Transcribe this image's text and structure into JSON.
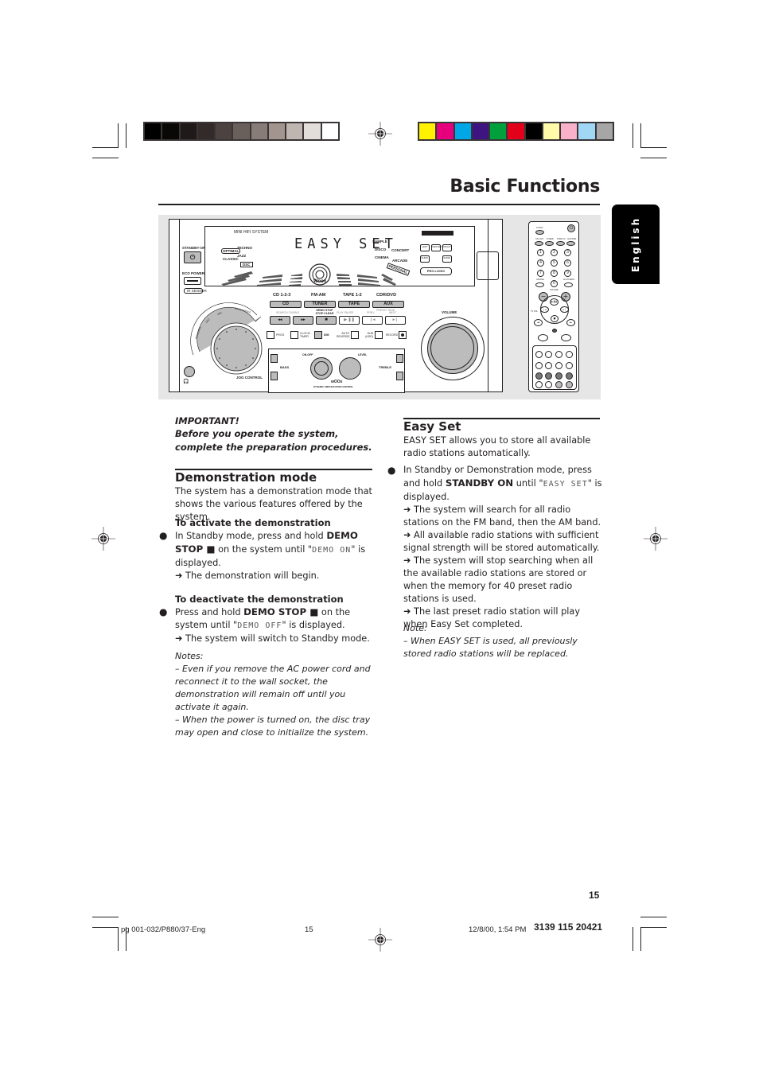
{
  "page": {
    "title": "Basic Functions",
    "language_tab": "English",
    "page_number": "15"
  },
  "color_bars": {
    "grayscale": [
      "#000000",
      "#0a0707",
      "#1f1a19",
      "#332b2a",
      "#4c4340",
      "#6a605b",
      "#877c77",
      "#a2958f",
      "#c0b6b1",
      "#e2ddda",
      "#ffffff"
    ],
    "process": [
      "#fff200",
      "#e6007e",
      "#00a7e7",
      "#3d1480",
      "#00a13d",
      "#e2001a",
      "#000000",
      "#fffaa8",
      "#f8b1c8",
      "#9fd7f4",
      "#a6a6a6"
    ]
  },
  "illustration": {
    "unit": {
      "brand_label": "MINI HIFI SYSTEM",
      "display_text": "EASY SET",
      "standby_label": "STANDBY-ON",
      "eco_power_label": "ECO POWER",
      "ir_sensor_label": "IR SENSOR",
      "source_labels": [
        "CD 1-2-3",
        "FM-AM",
        "TAPE 1-2",
        "CDR/DVD"
      ],
      "source_buttons": [
        "CD",
        "TUNER",
        "TAPE",
        "AUX"
      ],
      "transport_labels": [
        "SEARCH·TUNING",
        "DEMO STOP STOP·CLEAR",
        "PLAY PAUSE",
        "PREV",
        "PRESET SIDE",
        "NEXT"
      ],
      "transport_buttons": [
        "◂◂",
        "▸▸",
        "■",
        "▶ ❚❚",
        "❘◂",
        "▸❘"
      ],
      "function_buttons": [
        "PROG",
        "CLOCK/ TIMER",
        "DIM",
        "AUTO REVERSE",
        "DUB (HSD)",
        "RECORD"
      ],
      "jog_segments": [
        "PERSONAL",
        "DSC",
        "VEC",
        "BASS/TREBLE"
      ],
      "jog_label": "JOG CONTROL",
      "volume_label": "VOLUME",
      "tone": {
        "on_off": "ON-OFF",
        "level": "LEVEL",
        "bass": "BASS",
        "treble": "TREBLE",
        "wooox": "wOOx",
        "subtitle": "DYNAMIC AMPLIFICATION CONTROL"
      },
      "pro_logic_label": "PRO LOGIC",
      "surround_buttons": [
        "LEFT",
        "CENTER",
        "RIGHT",
        "SURR.",
        "SURR."
      ],
      "display_modes_left": [
        "OPTIMAL",
        "TECHNO",
        "CLASSIC",
        "JAZZ",
        "DSC"
      ],
      "display_modes_right": [
        "SAMPLE",
        "DISCO",
        "CONCERT",
        "CINEMA",
        "ARCADE",
        "PERSONAL"
      ],
      "woox_lcd": "Woox"
    },
    "remote": {
      "top_buttons": [
        "TV/AV",
        "CD 1/2/3",
        "TUNER",
        "TAPE 1/2",
        "AUX/CDR"
      ],
      "number_keys": [
        "1",
        "2",
        "3",
        "4",
        "5",
        "6",
        "7",
        "8",
        "9",
        "0"
      ],
      "labels": [
        "CANCEL",
        "AUTO REPL.",
        "VOLUME",
        "TV VOL"
      ]
    }
  },
  "left_column": {
    "important_heading": "IMPORTANT!",
    "important_text": "Before you operate the system, complete the preparation procedures.",
    "section_title": "Demonstration mode",
    "intro": "The system has a demonstration mode that shows the various features offered by the system.",
    "activate": {
      "heading": "To activate the demonstration",
      "step_pre": "In Standby mode",
      "step_mid": ", press and hold ",
      "step_bold": "DEMO STOP ■",
      "step_post1": " on the system until \"",
      "lcd": "DEMO ON",
      "step_post2": "\" is displayed.",
      "result": "➜ The demonstration will begin."
    },
    "deactivate": {
      "heading": "To deactivate the demonstration",
      "step_pre": "Press and hold ",
      "step_bold": "DEMO STOP  ■",
      "step_post1": " on the system until \"",
      "lcd": "DEMO OFF",
      "step_post2": "\" is displayed.",
      "result": "➜ The system will switch to Standby mode."
    },
    "notes_heading": "Notes:",
    "notes": [
      "–  Even if you remove the AC power cord and reconnect it to the wall socket, the demonstration will remain off until you activate it again.",
      "–  When the power is turned on, the disc tray may open and close to initialize the system."
    ]
  },
  "right_column": {
    "section_title": "Easy Set",
    "intro": "EASY SET allows you to store all available radio stations automatically.",
    "step_pre": "In Standby or Demonstration mode",
    "step_mid": ", press and hold ",
    "step_bold": "STANDBY ON",
    "step_post1": " until \"",
    "lcd": "EASY SET",
    "step_post2": "\" is displayed.",
    "results": [
      "➜ The system will search for all radio stations on the FM band, then the AM band.",
      "➜ All available radio stations with sufficient signal strength will be stored automatically.",
      "➜ The system will stop searching when all the available radio stations are stored or when the memory for 40 preset radio stations is used.",
      "➜ The last preset radio station will play when Easy Set completed."
    ],
    "note_heading": "Note:",
    "note": "–  When EASY SET is used, all previously stored radio stations will be replaced."
  },
  "footer": {
    "file_ref": "pg 001-032/P880/37-Eng",
    "page": "15",
    "timestamp": "12/8/00, 1:54 PM",
    "doc_number": "3139 115 20421"
  }
}
